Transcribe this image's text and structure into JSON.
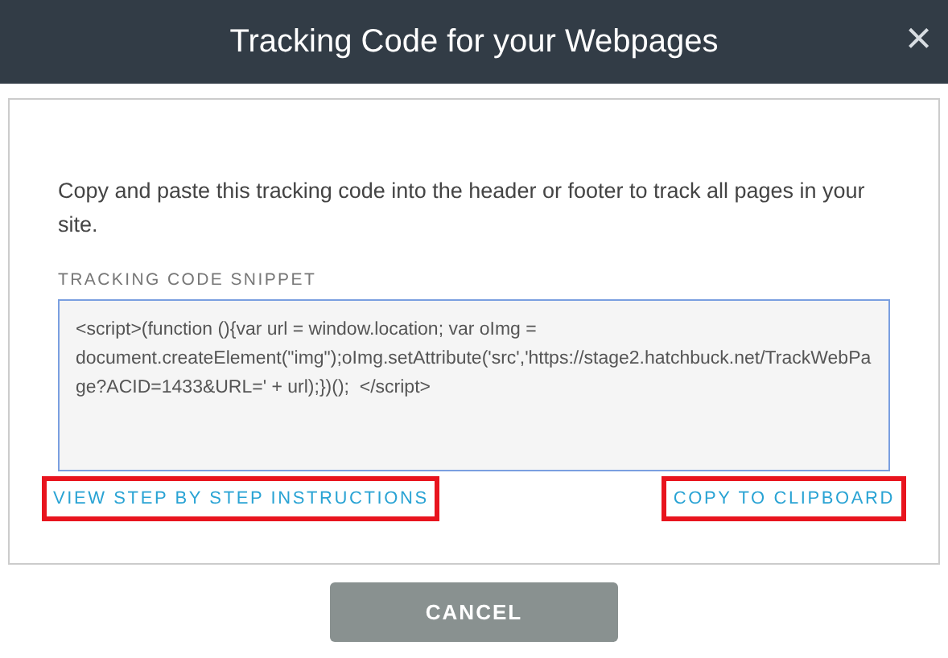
{
  "window": {
    "title": "Tracking Code for your Webpages",
    "close": "×"
  },
  "intro": "Copy and paste this tracking code into the header or footer to track all pages in your site.",
  "snippet": {
    "label": "TRACKING CODE SNIPPET",
    "value": "<script>(function (){var url = window.location; var oImg = document.createElement(\"img\");oImg.setAttribute('src','https://stage2.hatchbuck.net/TrackWebPage?ACID=1433&URL=' + url);})();  </script>"
  },
  "links": [
    {
      "label": "VIEW STEP BY STEP INSTRUCTIONS",
      "highlighted": true
    },
    {
      "label": "COPY TO CLIPBOARD",
      "highlighted": true
    }
  ],
  "buttons": [
    "CANCEL"
  ]
}
